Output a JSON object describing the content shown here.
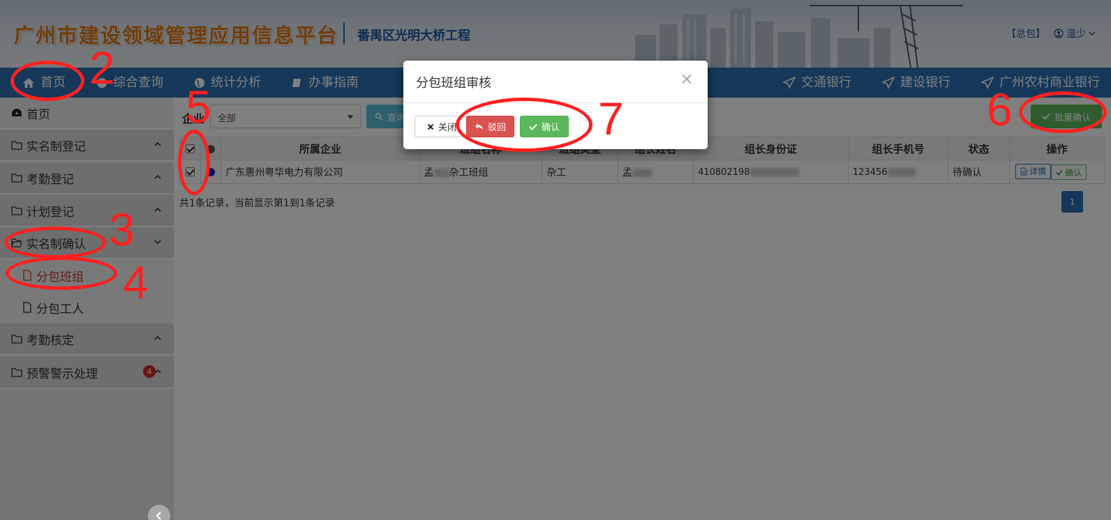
{
  "header": {
    "app_title": "广州市建设领域管理应用信息平台",
    "project_name": "番禺区光明大桥工程",
    "role": "【总包】",
    "user": "温少"
  },
  "nav": {
    "items": [
      "首页",
      "综合查询",
      "统计分析",
      "办事指南"
    ],
    "banks": [
      "交通银行",
      "建设银行",
      "广州农村商业银行"
    ]
  },
  "sidebar": {
    "home": "首页",
    "groups": [
      "实名制登记",
      "考勤登记",
      "计划登记",
      "实名制确认",
      "考勤核定",
      "预警警示处理"
    ],
    "sub_items": [
      "分包班组",
      "分包工人"
    ],
    "badge_count": "4"
  },
  "filter": {
    "label": "企业",
    "select_value": "全部",
    "query_button": "查询"
  },
  "batch_confirm": "批量确认",
  "table": {
    "headers": [
      "所属企业",
      "班组名称",
      "班组类型",
      "组长姓名",
      "组长身份证",
      "组长手机号",
      "状态",
      "操作"
    ],
    "row": {
      "company": "广东惠州粤华电力有限公司",
      "team_prefix": "孟",
      "team_suffix": "杂工班组",
      "team_type": "杂工",
      "leader": "孟",
      "id_card": "410802198",
      "phone": "123456",
      "status": "待确认",
      "detail_btn": "详情",
      "confirm_btn": "确认"
    }
  },
  "records_text": "共1条记录，当前显示第1到1条记录",
  "pager_current": "1",
  "modal": {
    "title": "分包班组审核",
    "close_btn": "关闭",
    "reject_btn": "驳回",
    "confirm_btn": "确认"
  },
  "annotations": [
    "2",
    "3",
    "4",
    "5",
    "6",
    "7"
  ],
  "colors": {
    "nav_blue": "#2a6fb2",
    "success": "#5cb85c",
    "danger": "#d9534f",
    "annotation_red": "#ff2020"
  }
}
